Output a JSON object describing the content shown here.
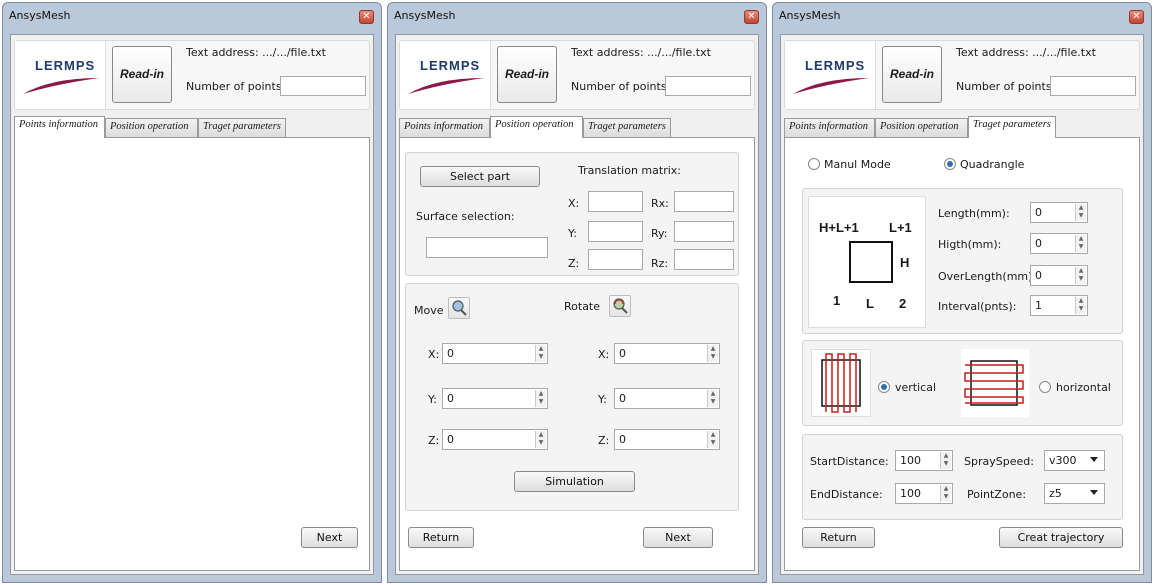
{
  "app_title": "AnsysMesh",
  "header": {
    "logo_text": "LERMPS",
    "readin_label": "Read-in",
    "address_label": "Text address: .../.../file.txt",
    "points_label": "Number of points:",
    "points_value": ""
  },
  "tabs": [
    "Points information",
    "Position operation",
    "Traget parameters"
  ],
  "window1": {
    "next_label": "Next"
  },
  "window2": {
    "select_part_label": "Select part",
    "surface_selection_label": "Surface selection:",
    "translation_matrix_label": "Translation matrix:",
    "matrix_labels": [
      "X:",
      "Rx:",
      "Y:",
      "Ry:",
      "Z:",
      "Rz:"
    ],
    "move_label": "Move",
    "rotate_label": "Rotate",
    "axis_labels": [
      "X:",
      "Y:",
      "Z:"
    ],
    "move_values": [
      "0",
      "0",
      "0"
    ],
    "rotate_values": [
      "0",
      "0",
      "0"
    ],
    "simulation_label": "Simulation",
    "return_label": "Return",
    "next_label": "Next"
  },
  "window3": {
    "mode_manual": "Manul Mode",
    "mode_quad": "Quadrangle",
    "diagram": {
      "top_left": "H+L+1",
      "top_right": "L+1",
      "right": "H",
      "bottom_left": "1",
      "bottom_mid": "L",
      "bottom_right": "2"
    },
    "params": [
      {
        "label": "Length(mm):",
        "value": "0"
      },
      {
        "label": "Higth(mm):",
        "value": "0"
      },
      {
        "label": "OverLength(mm):",
        "value": "0"
      },
      {
        "label": "Interval(pnts):",
        "value": "1"
      }
    ],
    "vertical_label": "vertical",
    "horizontal_label": "horizontal",
    "start_distance_label": "StartDistance:",
    "start_distance_value": "100",
    "end_distance_label": "EndDistance:",
    "end_distance_value": "100",
    "spray_speed_label": "SpraySpeed:",
    "spray_speed_value": "v300",
    "point_zone_label": "PointZone:",
    "point_zone_value": "z5",
    "return_label": "Return",
    "creat_label": "Creat trajectory"
  },
  "colors": {
    "accent_radio": "#2f6db5",
    "path_red": "#cc1b1b",
    "logo_blue": "#1f3a6d",
    "logo_swoosh": "#8b1a4a"
  }
}
